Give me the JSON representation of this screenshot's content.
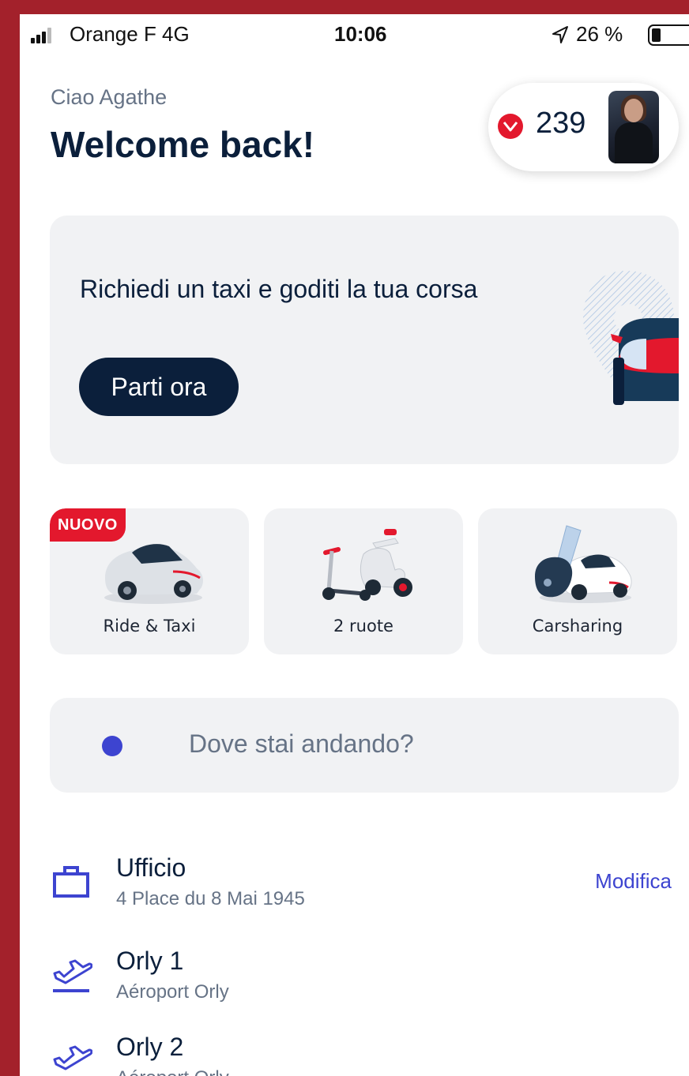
{
  "status_bar": {
    "carrier": "Orange F  4G",
    "time": "10:06",
    "battery_text": "26 %",
    "battery_level": 0.26
  },
  "header": {
    "greeting": "Ciao Agathe",
    "title": "Welcome back!",
    "points": "239"
  },
  "promo": {
    "text": "Richiedi un taxi e goditi la tua corsa",
    "button": "Parti ora"
  },
  "modes": [
    {
      "label": "Ride & Taxi",
      "badge": "NUOVO",
      "icon": "car-icon"
    },
    {
      "label": "2 ruote",
      "icon": "scooter-icon"
    },
    {
      "label": "Carsharing",
      "icon": "car-key-icon"
    }
  ],
  "search": {
    "placeholder": "Dove stai andando?"
  },
  "places": [
    {
      "name": "Ufficio",
      "address": "4 Place du 8 Mai 1945",
      "action": "Modifica",
      "icon": "briefcase-icon"
    },
    {
      "name": "Orly 1",
      "address": "Aéroport Orly",
      "icon": "airplane-icon"
    },
    {
      "name": "Orly 2",
      "address": "Aéroport Orly",
      "icon": "airplane-icon"
    }
  ],
  "colors": {
    "brand_red": "#e3182d",
    "navy": "#0b1f3b",
    "accent_blue": "#3d44d0",
    "card_gray": "#f1f2f4",
    "frame_red": "#a3212b"
  }
}
